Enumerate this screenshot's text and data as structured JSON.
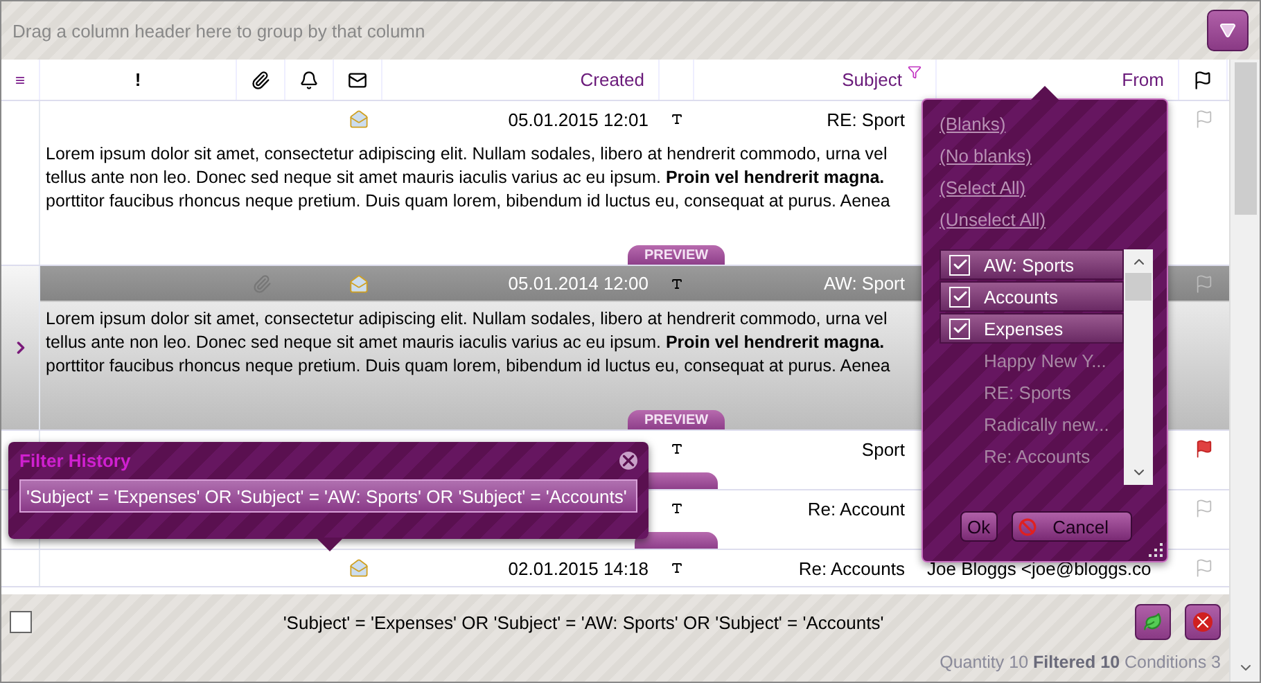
{
  "group_panel": {
    "hint": "Drag a column header here to group by that column"
  },
  "columns": [
    {
      "kind": "menu"
    },
    {
      "kind": "importance",
      "label": "!"
    },
    {
      "kind": "attachment"
    },
    {
      "kind": "reminder"
    },
    {
      "kind": "read"
    },
    {
      "kind": "text",
      "label": "Created",
      "filtered": false
    },
    {
      "kind": "type"
    },
    {
      "kind": "text",
      "label": "Subject",
      "filtered": true
    },
    {
      "kind": "text",
      "label": "From",
      "filtered": false
    },
    {
      "kind": "flag"
    }
  ],
  "rows": [
    {
      "selected": false,
      "attachment": false,
      "envelope": true,
      "created": "05.01.2015 12:01",
      "subject": "RE: Sport",
      "from": "",
      "flagged": false,
      "preview": "Lorem ipsum dolor sit amet, consectetur adipiscing elit. Nullam sodales, libero at hendrerit commodo, urna vel tellus ante non leo. Donec sed neque sit amet mauris iaculis varius ac eu ipsum. **Proin vel hendrerit magna.** porttitor faucibus rhoncus neque pretium. Duis quam lorem, bibendum id luctus eu, consequat at purus. Aenea",
      "preview_tab": "PREVIEW"
    },
    {
      "selected": true,
      "attachment": true,
      "envelope": true,
      "created": "05.01.2014 12:00",
      "subject": "AW: Sport",
      "from": "",
      "flagged": false,
      "preview": "Lorem ipsum dolor sit amet, consectetur adipiscing elit. Nullam sodales, libero at hendrerit commodo, urna vel tellus ante non leo. Donec sed neque sit amet mauris iaculis varius ac eu ipsum. **Proin vel hendrerit magna.** porttitor faucibus rhoncus neque pretium. Duis quam lorem, bibendum id luctus eu, consequat at purus. Aenea",
      "preview_tab": "PREVIEW"
    },
    {
      "selected": false,
      "attachment": false,
      "envelope": false,
      "created": "",
      "subject": "Sport",
      "from": "",
      "flagged": true,
      "preview": "",
      "preview_tab": ""
    },
    {
      "selected": false,
      "attachment": false,
      "envelope": false,
      "created": "",
      "subject": "Re: Account",
      "from": "",
      "flagged": false,
      "preview": "",
      "preview_tab": ""
    },
    {
      "selected": false,
      "attachment": false,
      "envelope": true,
      "created": "02.01.2015 14:18",
      "subject": "Re: Accounts",
      "from": "Joe Bloggs <joe@bloggs.co",
      "flagged": false,
      "preview": "",
      "preview_tab": ""
    }
  ],
  "filter_popup": {
    "links": [
      "(Blanks)",
      "(No blanks)",
      "(Select All)",
      "(Unselect All)"
    ],
    "items": [
      {
        "label": "AW: Sports",
        "checked": true
      },
      {
        "label": "Accounts",
        "checked": true
      },
      {
        "label": "Expenses",
        "checked": true
      },
      {
        "label": "Happy New Y...",
        "checked": false
      },
      {
        "label": "RE: Sports",
        "checked": false
      },
      {
        "label": "Radically new...",
        "checked": false
      },
      {
        "label": "Re: Accounts",
        "checked": false
      }
    ],
    "ok": "Ok",
    "cancel": "Cancel"
  },
  "filter_history": {
    "title": "Filter History",
    "value": "'Subject' = 'Expenses' OR 'Subject' = 'AW: Sports' OR 'Subject' = 'Accounts'"
  },
  "footer": {
    "checked": false,
    "filter_text": "'Subject' = 'Expenses' OR 'Subject' = 'AW: Sports' OR 'Subject' = 'Accounts'",
    "status": "Quantity 10 **Filtered 10** Conditions 3"
  }
}
